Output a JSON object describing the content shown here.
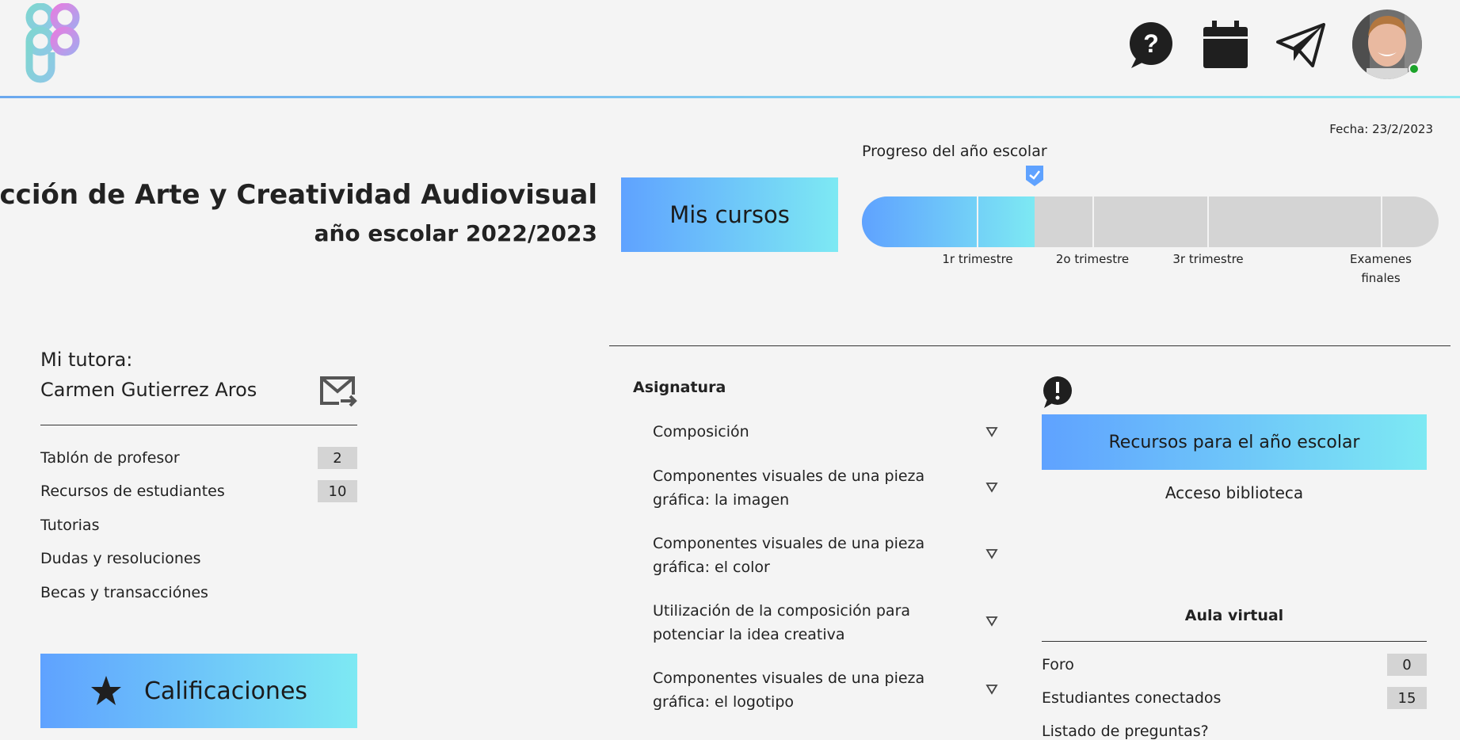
{
  "header": {
    "logo": "figma-logo",
    "icons": [
      "help-bubble-icon",
      "calendar-icon",
      "paper-plane-icon"
    ],
    "user": {
      "avatar": "user-avatar",
      "status": "online",
      "status_color": "#1ca32a"
    }
  },
  "date_label": "Fecha: 23/2/2023",
  "course": {
    "title": "Dirección de Arte y Creatividad Audiovisual",
    "subtitle": "año escolar 2022/2023"
  },
  "mis_cursos_label": "Mis cursos",
  "progress": {
    "label": "Progreso del año escolar",
    "value_fraction": 0.3,
    "ticks": [
      {
        "label": "1r trimestre"
      },
      {
        "label": "2o trimestre"
      },
      {
        "label": "3r trimestre"
      },
      {
        "label_line1": "Examenes",
        "label_line2": "finales"
      }
    ]
  },
  "tutor": {
    "heading": "Mi tutora:",
    "name": "Carmen Gutierrez Aros",
    "items": [
      {
        "label": "Tablón de profesor",
        "count": "2"
      },
      {
        "label": "Recursos de estudiantes",
        "count": "10"
      },
      {
        "label": "Tutorias"
      },
      {
        "label": "Dudas y resoluciones"
      },
      {
        "label": "Becas y transacciónes"
      }
    ]
  },
  "calificaciones_label": "Calificaciones",
  "asignatura": {
    "heading": "Asignatura",
    "items": [
      {
        "line1": "Composición",
        "line2": ""
      },
      {
        "line1": "Componentes visuales de una pieza",
        "line2": "gráfica: la imagen"
      },
      {
        "line1": "Componentes visuales de una pieza",
        "line2": "gráfica: el color"
      },
      {
        "line1": "Utilización de la composición para",
        "line2": "potenciar la idea creativa"
      },
      {
        "line1": "Componentes visuales de una pieza",
        "line2": "gráfica: el logotipo"
      }
    ]
  },
  "recursos_label": "Recursos para el año escolar",
  "biblioteca_label": "Acceso biblioteca",
  "aula": {
    "heading": "Aula virtual",
    "items": [
      {
        "label": "Foro",
        "count": "0"
      },
      {
        "label": "Estudiantes conectados",
        "count": "15"
      },
      {
        "label": "Listado de preguntas?"
      }
    ]
  },
  "colors": {
    "gradient_start": "#5fa2ff",
    "gradient_end": "#7de9f3",
    "track": "#d4d4d4",
    "background": "#f4f4f4"
  }
}
